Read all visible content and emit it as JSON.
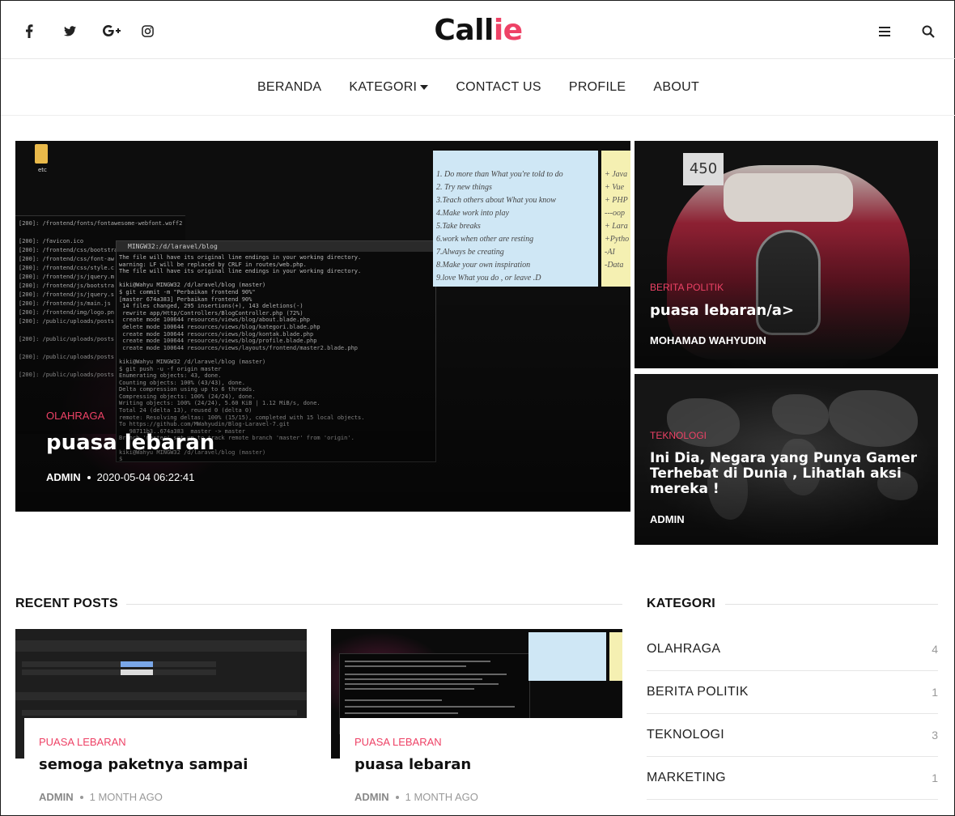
{
  "header": {
    "logo_main": "Call",
    "logo_accent": "ie",
    "social": [
      "facebook-icon",
      "twitter-icon",
      "google-plus-icon",
      "instagram-icon"
    ],
    "accent_color": "#ee4266"
  },
  "nav": {
    "items": [
      "BERANDA",
      "KATEGORI",
      "CONTACT US",
      "PROFILE",
      "ABOUT"
    ]
  },
  "featured": {
    "main": {
      "category": "OLAHRAGA",
      "title": "puasa lebaran",
      "author": "ADMIN",
      "date": "2020-05-04 06:22:41",
      "folder_label": "etc",
      "terminal_title": "MINGW32:/d/laravel/blog",
      "note_lines": "1. Do more than What you're told to do\n2. Try new things\n3.Teach others about What you know\n4.Make work into play\n5.Take breaks\n6.work when other are resting\n7.Always be creating\n8.Make your own inspiration\n9.love What you do , or leave .D",
      "note2_lines": "+ Java\n+ Vue\n+ PHP\n---oop\n+ Lara\n+Pytho\n-AI\n-Data"
    },
    "side_top": {
      "category": "BERITA POLITIK",
      "title": "puasa lebaran/a>",
      "author": "MOHAMAD WAHYUDIN",
      "plate": "450"
    },
    "side_bottom": {
      "category": "TEKNOLOGI",
      "title": "Ini Dia, Negara yang Punya Gamer Terhebat di Dunia , Lihatlah aksi mereka !",
      "author": "ADMIN"
    }
  },
  "recent": {
    "heading": "RECENT POSTS",
    "posts": [
      {
        "category": "PUASA LEBARAN",
        "title": "semoga paketnya sampai",
        "author": "ADMIN",
        "time": "1 MONTH AGO"
      },
      {
        "category": "PUASA LEBARAN",
        "title": "puasa lebaran",
        "author": "ADMIN",
        "time": "1 MONTH AGO"
      }
    ]
  },
  "kategori": {
    "heading": "KATEGORI",
    "items": [
      {
        "name": "OLAHRAGA",
        "count": "4"
      },
      {
        "name": "BERITA POLITIK",
        "count": "1"
      },
      {
        "name": "TEKNOLOGI",
        "count": "3"
      },
      {
        "name": "MARKETING",
        "count": "1"
      }
    ]
  }
}
